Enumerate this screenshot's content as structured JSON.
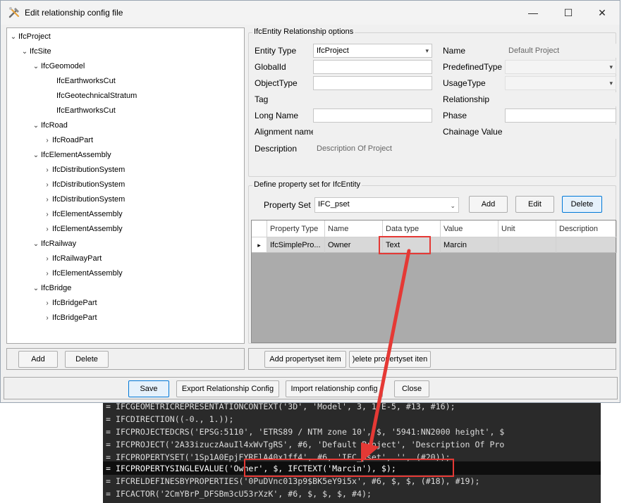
{
  "window": {
    "title": "Edit relationship config file",
    "controls": {
      "minimize": "—",
      "maximize": "☐",
      "close": "✕"
    }
  },
  "tree": {
    "items": [
      {
        "label": "IfcProject",
        "chevron": "v"
      },
      {
        "label": "IfcSite",
        "chevron": "v"
      },
      {
        "label": "IfcGeomodel",
        "chevron": "v"
      },
      {
        "label": "IfcEarthworksCut",
        "chevron": ""
      },
      {
        "label": "IfcGeotechnicalStratum",
        "chevron": ""
      },
      {
        "label": "IfcEarthworksCut",
        "chevron": ""
      },
      {
        "label": "IfcRoad",
        "chevron": "v"
      },
      {
        "label": "IfcRoadPart",
        "chevron": ">"
      },
      {
        "label": "IfcElementAssembly",
        "chevron": "v"
      },
      {
        "label": "IfcDistributionSystem",
        "chevron": ">"
      },
      {
        "label": "IfcDistributionSystem",
        "chevron": ">"
      },
      {
        "label": "IfcDistributionSystem",
        "chevron": ">"
      },
      {
        "label": "IfcElementAssembly",
        "chevron": ">"
      },
      {
        "label": "IfcElementAssembly",
        "chevron": ">"
      },
      {
        "label": "IfcRailway",
        "chevron": "v"
      },
      {
        "label": "IfcRailwayPart",
        "chevron": ">"
      },
      {
        "label": "IfcElementAssembly",
        "chevron": ">"
      },
      {
        "label": "IfcBridge",
        "chevron": "v"
      },
      {
        "label": "IfcBridgePart",
        "chevron": ">"
      },
      {
        "label": "IfcBridgePart",
        "chevron": ">"
      }
    ]
  },
  "relationship": {
    "group_title": "IfcEntity Relationship options",
    "entity_type_label": "Entity Type",
    "entity_type_value": "IfcProject",
    "name_label": "Name",
    "name_value": "Default Project",
    "globalid_label": "GlobalId",
    "predefinedtype_label": "PredefinedType",
    "objecttype_label": "ObjectType",
    "usagetype_label": "UsageType",
    "tag_label": "Tag",
    "relationship_label": "Relationship",
    "longname_label": "Long Name",
    "phase_label": "Phase",
    "alignment_label": "Alignment name",
    "chainage_label": "Chainage Value",
    "description_label": "Description",
    "description_value": "Description Of Project"
  },
  "pset": {
    "group_title": "Define property set for IfcEntity",
    "property_set_label": "Property Set",
    "property_set_value": "IFC_pset",
    "add_label": "Add",
    "edit_label": "Edit",
    "delete_label": "Delete",
    "columns": [
      "Property Type",
      "Name",
      "Data type",
      "Value",
      "Unit",
      "Description"
    ],
    "row": [
      "IfcSimplePro...",
      "Owner",
      "Text",
      "Marcin",
      "",
      ""
    ],
    "row_marker": "▸"
  },
  "tree_buttons": {
    "add": "Add",
    "delete": "Delete"
  },
  "pset_buttons": {
    "add_item": "Add propertyset item",
    "delete_item": ")elete propertyset iten"
  },
  "footer": {
    "save": "Save",
    "export": "Export Relationship Config",
    "import": "Import relationship config",
    "close": "Close"
  },
  "code": {
    "lines": [
      "= IFCGEOMETRICREPRESENTATIONCONTEXT('3D', 'Model', 3, 1.E-5, #13, #16);",
      "= IFCDIRECTION((-0., 1.));",
      "= IFCPROJECTEDCRS('EPSG:5110', 'ETRS89 / NTM zone 10', $, '5941:NN2000 height', $",
      "= IFCPROJECT('2A33izuczAauIl4xWvTgRS', #6, 'Default Project', 'Description Of Pro",
      "= IFCPROPERTYSET('1Sp1A0EpjFYRElA40x1ff4', #6, 'IFC_pset', '', (#20));",
      "= IFCPROPERTYSINGLEVALUE('Owner', $, IFCTEXT('Marcin'), $);",
      "= IFCRELDEFINESBYPROPERTIES('0PuDVnc013p9$BK5eY9i5x', #6, $, $, (#18), #19);",
      "= IFCACTOR('2CmYBrP_DFSBm3cU53rXzK', #6, $, $, $, #4);"
    ]
  },
  "colors": {
    "highlight_red": "#e53935",
    "selection_blue": "#0078d7",
    "code_bg": "#2a2a2a"
  }
}
